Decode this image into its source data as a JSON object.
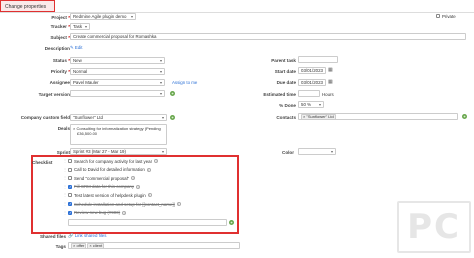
{
  "header": {
    "title": "Change properties"
  },
  "form": {
    "project": {
      "label": "Project",
      "value": "Redmine Agile plugin demo"
    },
    "private": {
      "label": "Private"
    },
    "tracker": {
      "label": "Tracker",
      "value": "Task"
    },
    "subject": {
      "label": "Subject",
      "value": "Create commercial proposal for Romashka"
    },
    "description": {
      "label": "Description",
      "edit": "Edit"
    },
    "status": {
      "label": "Status",
      "value": "New"
    },
    "parent_task": {
      "label": "Parent task"
    },
    "priority": {
      "label": "Priority",
      "value": "Normal"
    },
    "start_date": {
      "label": "Start date",
      "value": "03/01/2023"
    },
    "assignee": {
      "label": "Assignee",
      "value": "Pavel Mauler",
      "assign_me": "Assign to me"
    },
    "due_date": {
      "label": "Due date",
      "value": "03/01/2023"
    },
    "target_version": {
      "label": "Target version"
    },
    "estimated_time": {
      "label": "Estimated time",
      "unit": "Hours"
    },
    "done": {
      "label": "% Done",
      "value": "50 %"
    },
    "company": {
      "label": "Company custom field",
      "value": "\"Sunflower\" Ltd"
    },
    "contacts": {
      "label": "Contacts",
      "value": "\"Sunflower\" Ltd"
    },
    "deals": {
      "label": "Deals",
      "items": [
        "Consulting for informatization strategy (Pending",
        "£36,500.00"
      ]
    },
    "sprint": {
      "label": "Sprint",
      "value": "Sprint #3 (Mar 27 - Mar 19)"
    },
    "color": {
      "label": "Color"
    },
    "checklist": {
      "label": "Checklist",
      "items": [
        {
          "text": "Search for company activity for last year",
          "done": false
        },
        {
          "text": "Call to David for detailed information",
          "done": false
        },
        {
          "text": "Send \"commercial proposal\"",
          "done": false
        },
        {
          "text": "Fill CRM data for this company",
          "done": true
        },
        {
          "text": "Test latest version of helpdesk plugin",
          "done": false
        },
        {
          "text": "Schedule installation and setup for [[contact_name]]",
          "done": true
        },
        {
          "text": "Review new bug (#900)",
          "done": true
        }
      ]
    },
    "shared_files": {
      "label": "Shared files",
      "link": "Link shared files"
    },
    "tags": {
      "label": "Tags",
      "items": [
        "offer",
        "client"
      ]
    }
  },
  "watermark": {
    "text": "PC"
  },
  "colors": {
    "highlight": "#e03030",
    "link": "#2a6fd6",
    "add": "#6aa84f"
  }
}
